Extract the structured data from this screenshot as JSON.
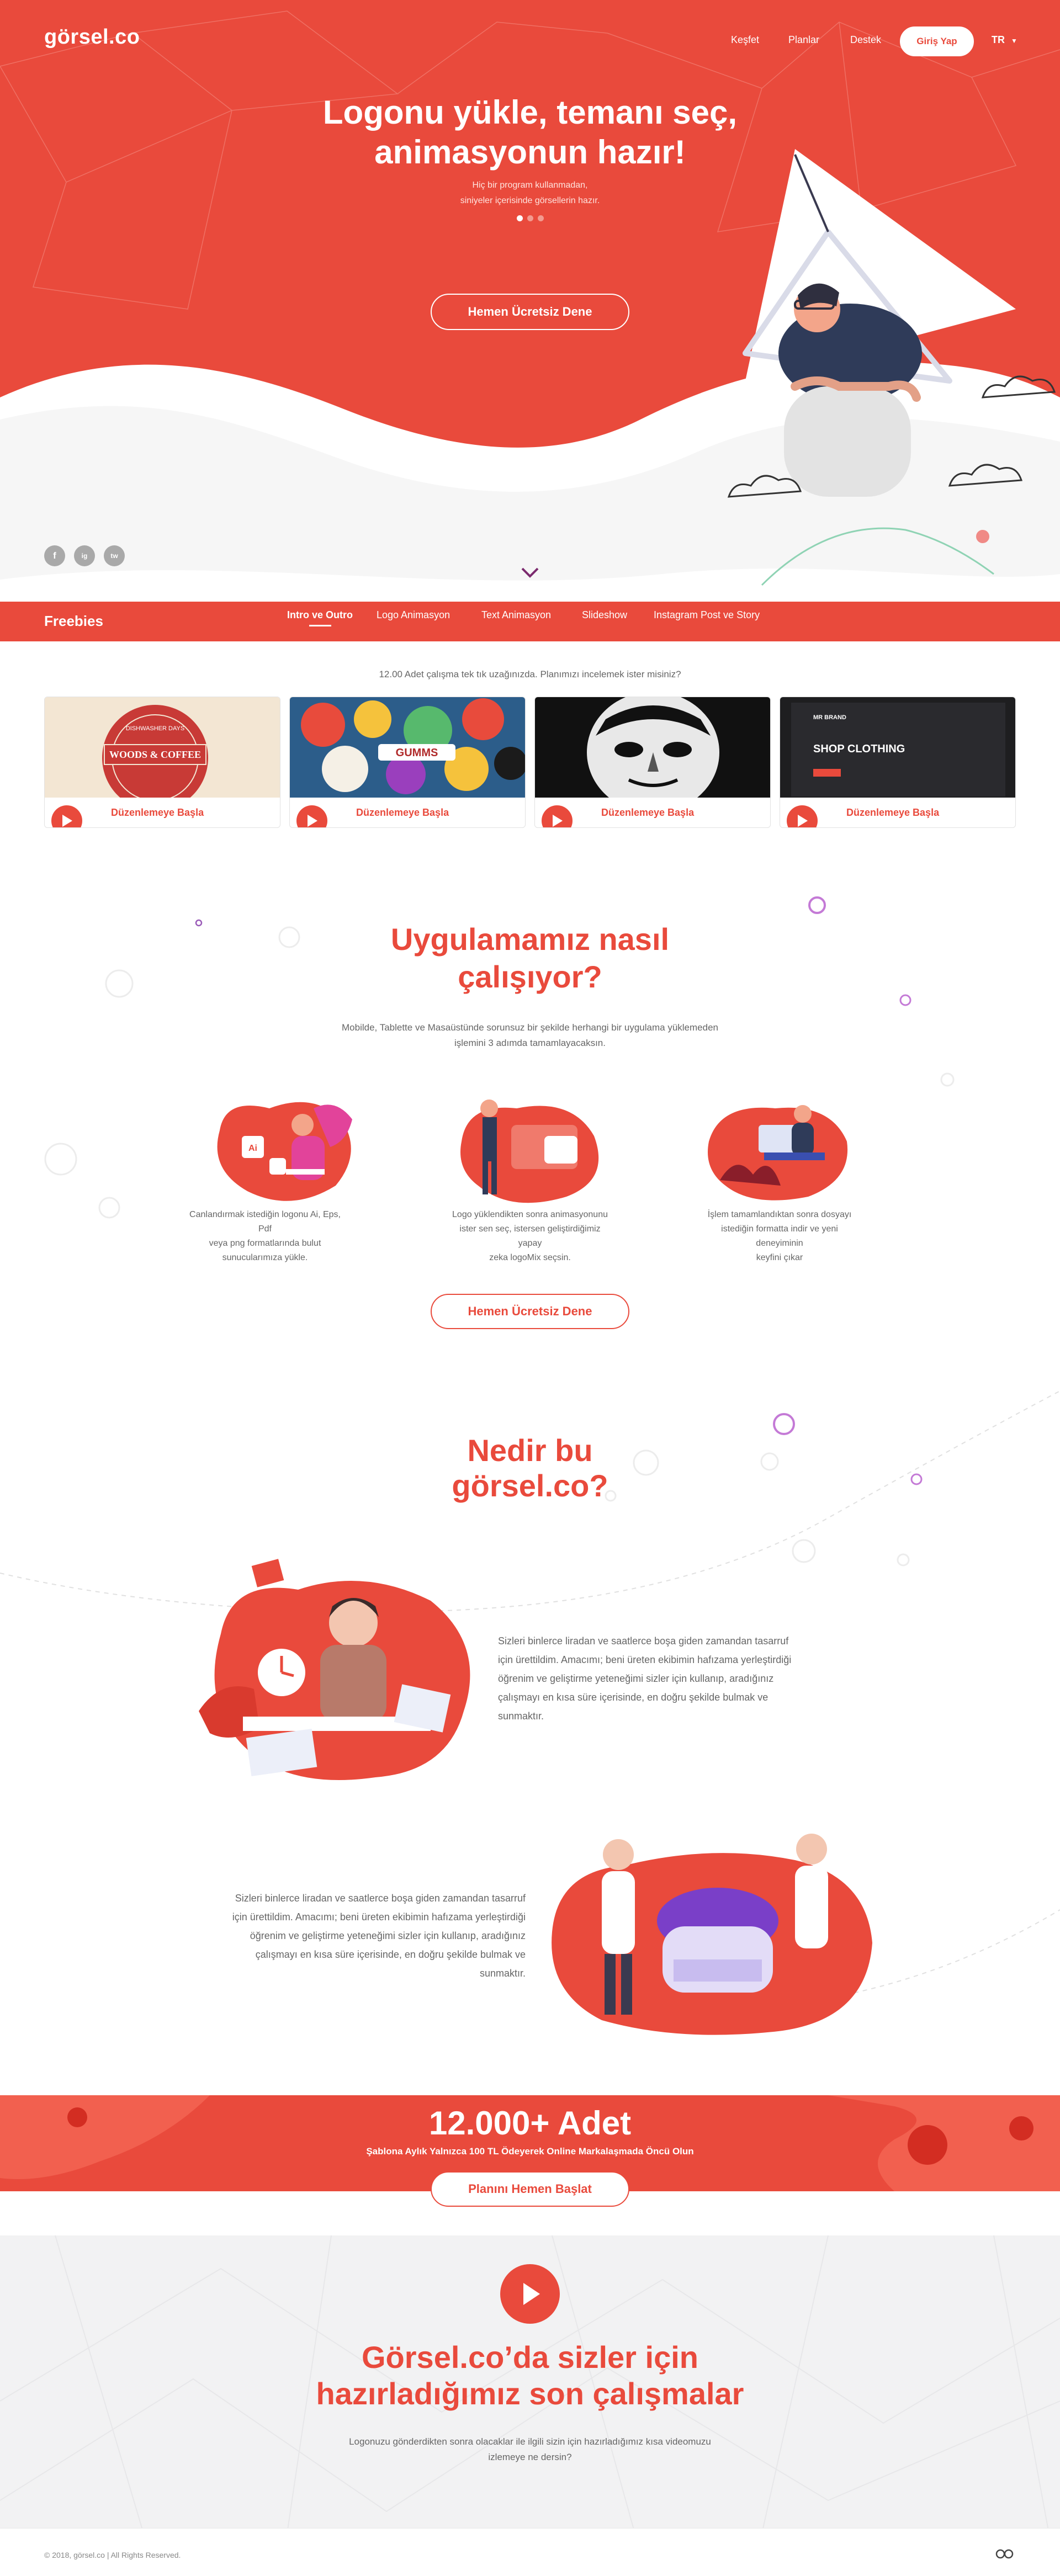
{
  "header": {
    "logo": "görsel.co",
    "nav": [
      "Keşfet",
      "Planlar",
      "Destek"
    ],
    "login_label": "Giriş Yap",
    "lang": "TR"
  },
  "hero": {
    "title_line1": "Logonu yükle, temanı seç,",
    "title_line2": "animasyonun hazır!",
    "subtitle_line1": "Hiç bir program kullanmadan,",
    "subtitle_line2": "siniyeler içerisinde görsellerin hazır.",
    "cta": "Hemen Ücretsiz Dene",
    "social": [
      "f",
      "ig",
      "tw"
    ]
  },
  "freebies": {
    "title": "Freebies",
    "tabs": [
      "Intro ve Outro",
      "Logo Animasyon",
      "Text Animasyon",
      "Slideshow",
      "Instagram Post ve Story"
    ],
    "note": "12.00 Adet çalışma tek tık uzağınızda. Planımızı incelemek ister misiniz?",
    "cards": [
      {
        "label": "Düzenlemeye Başla",
        "thumb_text": "WOODS & COFFEE",
        "thumb_top": "DISHWASHER DAYS"
      },
      {
        "label": "Düzenlemeye Başla",
        "thumb_text": "GUMMS"
      },
      {
        "label": "Düzenlemeye Başla"
      },
      {
        "label": "Düzenlemeye Başla",
        "thumb_text": "SHOP CLOTHING",
        "thumb_top": "MR BRAND"
      }
    ]
  },
  "how": {
    "title_line1": "Uygulamamız nasıl",
    "title_line2": "çalışıyor?",
    "desc_line1": "Mobilde, Tablette ve Masaüstünde sorunsuz bir şekilde herhangi bir uygulama yüklemeden",
    "desc_line2": "işlemini 3 adımda tamamlayacaksın.",
    "steps": [
      {
        "l1": "Canlandırmak istediğin logonu Ai, Eps, Pdf",
        "l2": "veya png formatlarında bulut",
        "l3": "sunucularımıza yükle."
      },
      {
        "l1": "Logo yüklendikten sonra animasyonunu",
        "l2": "ister sen seç, istersen geliştirdiğimiz yapay",
        "l3": "zeka logoMix seçsin."
      },
      {
        "l1": "İşlem tamamlandıktan sonra dosyayı",
        "l2": "istediğin formatta indir ve yeni deneyiminin",
        "l3": "keyfini çıkar"
      }
    ],
    "cta": "Hemen Ücretsiz Dene"
  },
  "what": {
    "title_line1": "Nedir bu",
    "title_line2": "görsel.co?",
    "para1": [
      "Sizleri binlerce liradan ve saatlerce boşa giden zamandan tasarruf",
      "için ürettildim. Amacımı; beni üreten ekibimin hafızama yerleştirdiği",
      "öğrenim ve geliştirme yeteneğimi sizler için kullanıp, aradığınız",
      "çalışmayı en kısa süre içerisinde, en doğru şekilde bulmak ve",
      "sunmaktır."
    ],
    "para2": [
      "Sizleri binlerce liradan ve saatlerce boşa giden zamandan tasarruf",
      "için ürettildim. Amacımı; beni üreten ekibimin hafızama yerleştirdiği",
      "öğrenim ve geliştirme yeteneğimi sizler için kullanıp, aradığınız",
      "çalışmayı en kısa süre içerisinde, en doğru şekilde bulmak ve",
      "sunmaktır."
    ]
  },
  "stats": {
    "big": "12.000+ Adet",
    "sub": "Şablona Aylık Yalnızca 100 TL Ödeyerek Online Markalaşmada Öncü Olun",
    "cta": "Planını Hemen Başlat"
  },
  "works": {
    "title_line1": "Görsel.co’da sizler için",
    "title_line2": "hazırladığımız son çalışmalar",
    "desc_line1": "Logonuzu gönderdikten sonra olacaklar ile ilgili sizin için hazırladığımız kısa videomuzu",
    "desc_line2": "izlemeye ne dersin?"
  },
  "footer": {
    "copyright": "© 2018, görsel.co  | All Rights Reserved."
  },
  "colors": {
    "accent": "#e94a3c",
    "accent_dark": "#d93a2e",
    "grey_bg": "#f2f2f3"
  }
}
